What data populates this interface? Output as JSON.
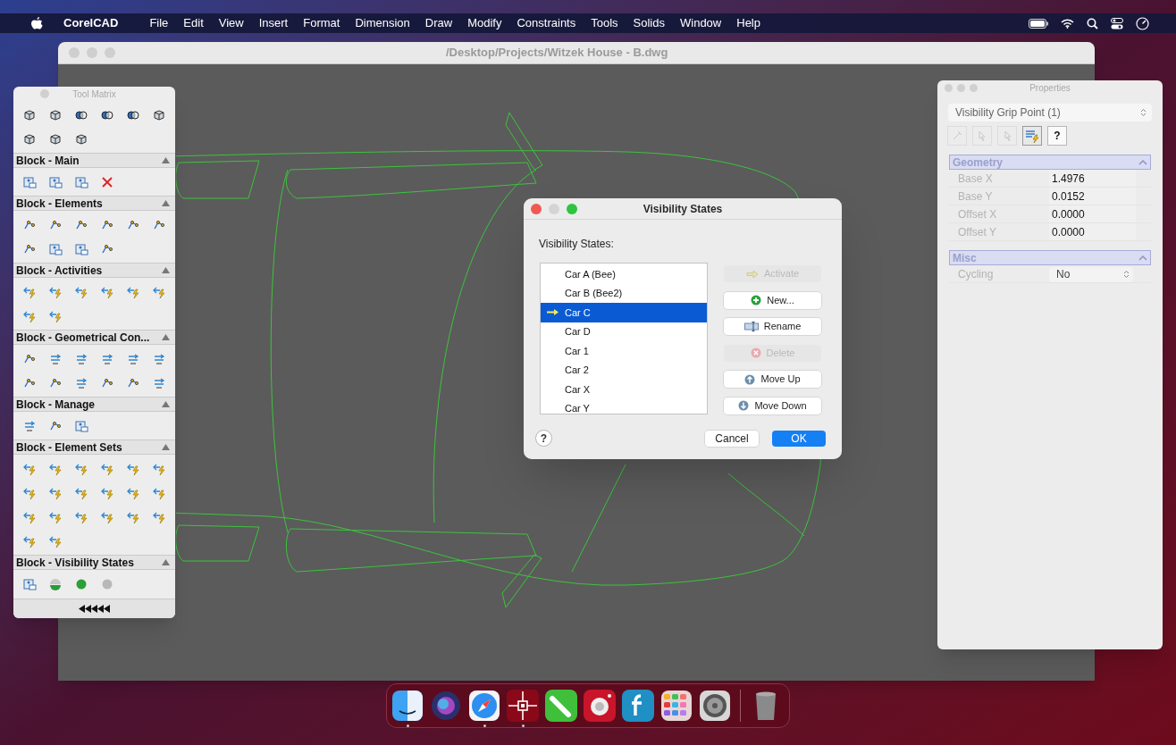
{
  "menu_bar": {
    "app": "CorelCAD",
    "items": [
      "File",
      "Edit",
      "View",
      "Insert",
      "Format",
      "Dimension",
      "Draw",
      "Modify",
      "Constraints",
      "Tools",
      "Solids",
      "Window",
      "Help"
    ]
  },
  "main_window": {
    "title": "/Desktop/Projects/Witzek House - B.dwg"
  },
  "tool_matrix": {
    "title": "Tool Matrix",
    "sections": [
      {
        "title": "Block - Main",
        "expanded": true
      },
      {
        "title": "Block - Elements",
        "expanded": true
      },
      {
        "title": "Block - Activities",
        "expanded": true
      },
      {
        "title": "Block - Geometrical Con...",
        "expanded": true
      },
      {
        "title": "Block - Manage",
        "expanded": true
      },
      {
        "title": "Block - Element Sets",
        "expanded": true
      },
      {
        "title": "Block - Visibility States",
        "expanded": true
      }
    ]
  },
  "dialog": {
    "title": "Visibility States",
    "label": "Visibility States:",
    "states": [
      {
        "name": "Car A (Bee)",
        "selected": false,
        "active": false
      },
      {
        "name": "Car B (Bee2)",
        "selected": false,
        "active": false
      },
      {
        "name": "Car C",
        "selected": true,
        "active": true
      },
      {
        "name": "Car D",
        "selected": false,
        "active": false
      },
      {
        "name": "Car 1",
        "selected": false,
        "active": false
      },
      {
        "name": "Car 2",
        "selected": false,
        "active": false
      },
      {
        "name": "Car X",
        "selected": false,
        "active": false
      },
      {
        "name": "Car Y",
        "selected": false,
        "active": false
      }
    ],
    "buttons": [
      {
        "kind": "activate",
        "label": "Activate",
        "disabled": true
      },
      {
        "kind": "new",
        "label": "New...",
        "disabled": false
      },
      {
        "kind": "rename",
        "label": "Rename",
        "disabled": false
      },
      {
        "kind": "delete",
        "label": "Delete",
        "disabled": true
      },
      {
        "kind": "up",
        "label": "Move Up",
        "disabled": false
      },
      {
        "kind": "down",
        "label": "Move Down",
        "disabled": false
      }
    ],
    "help": "?",
    "footer": [
      {
        "label": "Cancel",
        "default": false
      },
      {
        "label": "OK",
        "default": true
      }
    ]
  },
  "properties": {
    "title": "Properties",
    "selector": "Visibility Grip Point (1)",
    "toolbar": [
      {
        "kind": "pick",
        "disabled": true,
        "selected": false
      },
      {
        "kind": "cursor",
        "disabled": true,
        "selected": false
      },
      {
        "kind": "cursor2",
        "disabled": true,
        "selected": false
      },
      {
        "kind": "list",
        "disabled": false,
        "selected": true
      },
      {
        "kind": "text",
        "label": "?",
        "disabled": false,
        "selected": false
      }
    ],
    "groups": [
      {
        "title": "Geometry",
        "expanded": true,
        "rows": [
          {
            "kind": "field",
            "label": "Base X",
            "value": "1.4976"
          },
          {
            "kind": "field",
            "label": "Base Y",
            "value": "0.0152"
          },
          {
            "kind": "field",
            "label": "Offset X",
            "value": "0.0000"
          },
          {
            "kind": "field",
            "label": "Offset Y",
            "value": "0.0000"
          }
        ]
      },
      {
        "title": "Misc",
        "expanded": true,
        "rows": [
          {
            "kind": "select",
            "label": "Cycling",
            "value": "No"
          }
        ]
      }
    ]
  },
  "dock": [
    {
      "kind": "finder",
      "running": true
    },
    {
      "kind": "siri",
      "running": false
    },
    {
      "kind": "safari",
      "running": true
    },
    {
      "kind": "cad",
      "running": true
    },
    {
      "kind": "pencil",
      "running": false
    },
    {
      "kind": "camera",
      "running": false
    },
    {
      "kind": "font",
      "running": false
    },
    {
      "kind": "apps",
      "running": false
    },
    {
      "kind": "settings",
      "running": false
    },
    {
      "kind": "trash",
      "running": false
    }
  ]
}
